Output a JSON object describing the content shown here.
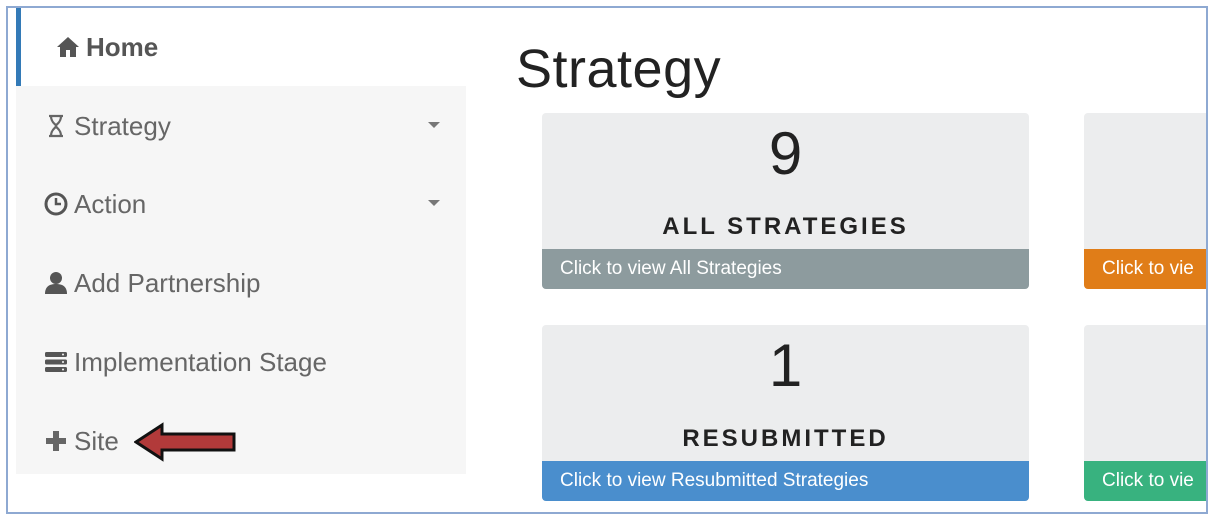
{
  "sidebar": {
    "items": [
      {
        "label": "Home",
        "icon": "home-icon"
      },
      {
        "label": "Strategy",
        "icon": "hourglass-icon",
        "has_dropdown": true
      },
      {
        "label": "Action",
        "icon": "clock-icon",
        "has_dropdown": true
      },
      {
        "label": "Add Partnership",
        "icon": "user-icon"
      },
      {
        "label": "Implementation Stage",
        "icon": "tasks-icon"
      },
      {
        "label": "Site",
        "icon": "plus-icon"
      }
    ],
    "active": "Home"
  },
  "annotation": {
    "icon": "red-arrow-icon",
    "color": "#b23a3a"
  },
  "main": {
    "title": "Strategy",
    "cards": [
      {
        "count": "9",
        "label": "ALL STRATEGIES",
        "footer": "Click to view All Strategies",
        "footer_color": "#8d9b9e"
      },
      {
        "count": "",
        "label": "",
        "footer": "Click to vie",
        "footer_color": "#e07d18"
      },
      {
        "count": "1",
        "label": "RESUBMITTED",
        "footer": "Click to view Resubmitted Strategies",
        "footer_color": "#4a8ecd"
      },
      {
        "count": "",
        "label": "",
        "footer": "Click to vie",
        "footer_color": "#38b27f"
      }
    ]
  },
  "colors": {
    "accent": "#337ab7",
    "frame_border": "#8ea9d2",
    "sidebar_bg": "#f6f6f6"
  }
}
